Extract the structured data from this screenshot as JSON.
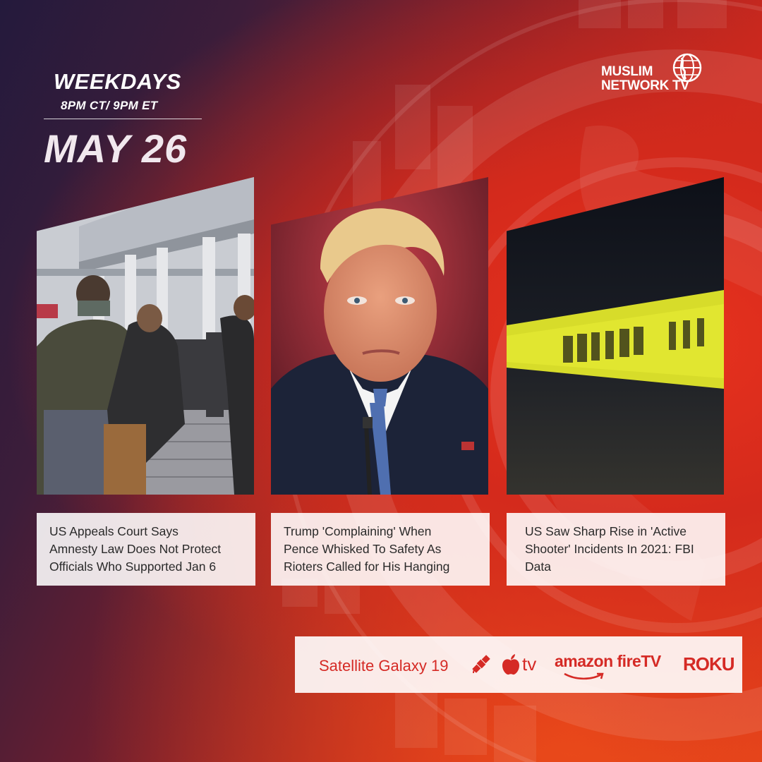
{
  "header": {
    "weekdays": "WEEKDAYS",
    "time": "8PM CT/ 9PM ET",
    "date": "MAY 26"
  },
  "logo": {
    "line1": "MUSLIM",
    "line2": "NETWORK TV",
    "icon": "globe-icon"
  },
  "stories": [
    {
      "caption": [
        "US Appeals Court Says",
        "Amnesty Law Does Not Protect",
        "Officials Who Supported Jan 6"
      ],
      "image": "capitol-rioters-photo"
    },
    {
      "caption": [
        "Trump 'Complaining' When",
        "Pence Whisked To Safety As",
        "Rioters Called for His Hanging"
      ],
      "image": "trump-portrait-photo"
    },
    {
      "caption": [
        "US Saw Sharp Rise in 'Active",
        "Shooter' Incidents In 2021: FBI",
        "Data"
      ],
      "image": "police-tape-photo"
    }
  ],
  "platforms": {
    "satellite": "Satellite Galaxy 19",
    "satellite_icon": "satellite-icon",
    "apple_icon": "apple-icon",
    "apple_tv": "tv",
    "amazon": "amazon fireTV",
    "roku": "ROKU"
  },
  "colors": {
    "accent_red": "#d52a25",
    "bg_dark": "#241a3c",
    "bg_red": "#de3a1c"
  }
}
